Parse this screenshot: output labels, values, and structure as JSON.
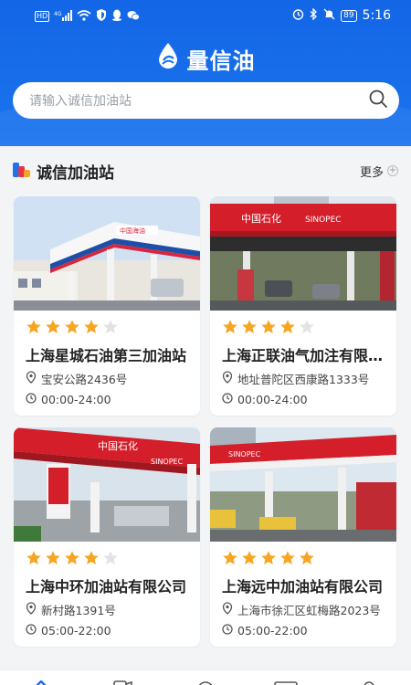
{
  "status_bar": {
    "left_icons": [
      "hd-icon",
      "signal-4g-icon",
      "wifi-icon",
      "shield-icon",
      "qq-icon",
      "wechat-icon"
    ],
    "right_icons": [
      "alarm-icon",
      "bluetooth-icon",
      "mute-icon"
    ],
    "hd_label": "HD",
    "signal_label": "⁴ᴳ",
    "battery": "89",
    "time": "5:16"
  },
  "app": {
    "title": "量信油",
    "primary_color": "#1366e6"
  },
  "search": {
    "placeholder": "请输入诚信加油站"
  },
  "section": {
    "title": "诚信加油站",
    "more_label": "更多",
    "more_icon": "+"
  },
  "stations": [
    {
      "name": "上海星城石油第三加油站",
      "rating": 4,
      "address": "宝安公路2436号",
      "hours": "00:00-24:00",
      "brand": "中国海油"
    },
    {
      "name": "上海正联油气加注有限公司",
      "rating": 4,
      "address": "地址普陀区西康路1333号",
      "hours": "00:00-24:00",
      "brand": "中国石化 SINOPEC"
    },
    {
      "name": "上海中环加油站有限公司",
      "rating": 4,
      "address": "新村路1391号",
      "hours": "05:00-22:00",
      "brand": "中国石化 SINOPEC"
    },
    {
      "name": "上海远中加油站有限公司",
      "rating": 5,
      "address": "上海市徐汇区虹梅路2023号",
      "hours": "05:00-22:00",
      "brand": "中国石化 SINOPEC"
    }
  ],
  "tabbar": {
    "icons": [
      "home-icon",
      "station-icon",
      "discover-icon",
      "message-icon",
      "profile-icon"
    ]
  }
}
